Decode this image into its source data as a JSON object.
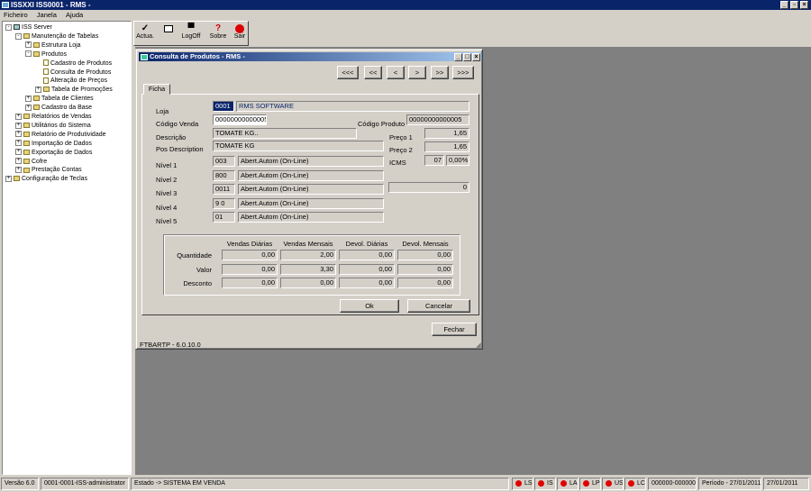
{
  "window": {
    "title": "ISSXXI ISS0001 - RMS -"
  },
  "menu": [
    "Ficheiro",
    "Janela",
    "Ajuda"
  ],
  "toolbar": [
    {
      "label": "Actua.",
      "icon": "check-icon"
    },
    {
      "label": "",
      "icon": "window-icon"
    },
    {
      "label": "LogOff",
      "icon": "logoff-icon"
    },
    {
      "label": "Sobre",
      "icon": "help-icon"
    },
    {
      "label": "Sair",
      "icon": "stop-icon"
    }
  ],
  "tree": [
    {
      "label": "ISS Server",
      "level": 0,
      "sign": "-",
      "kind": "computer"
    },
    {
      "label": "Manutenção de Tabelas",
      "level": 1,
      "sign": "-",
      "kind": "folder"
    },
    {
      "label": "Estrutura Loja",
      "level": 2,
      "sign": "+",
      "kind": "folder"
    },
    {
      "label": "Produtos",
      "level": 2,
      "sign": "-",
      "kind": "folder"
    },
    {
      "label": "Cadastro de Produtos",
      "level": 3,
      "sign": "",
      "kind": "doc"
    },
    {
      "label": "Consulta de Produtos",
      "level": 3,
      "sign": "",
      "kind": "doc"
    },
    {
      "label": "Alteração de Preços",
      "level": 3,
      "sign": "",
      "kind": "doc"
    },
    {
      "label": "Tabela de Promoções",
      "level": 3,
      "sign": "+",
      "kind": "folder"
    },
    {
      "label": "Tabela de Clientes",
      "level": 2,
      "sign": "+",
      "kind": "folder"
    },
    {
      "label": "Cadastro da Base",
      "level": 2,
      "sign": "+",
      "kind": "folder"
    },
    {
      "label": "Relatórios de Vendas",
      "level": 1,
      "sign": "+",
      "kind": "folder"
    },
    {
      "label": "Utilitários do Sistema",
      "level": 1,
      "sign": "+",
      "kind": "folder"
    },
    {
      "label": "Relatório de Produtividade",
      "level": 1,
      "sign": "+",
      "kind": "folder"
    },
    {
      "label": "Importação de Dados",
      "level": 1,
      "sign": "+",
      "kind": "folder"
    },
    {
      "label": "Exportação de Dados",
      "level": 1,
      "sign": "+",
      "kind": "folder"
    },
    {
      "label": "Cofre",
      "level": 1,
      "sign": "+",
      "kind": "folder"
    },
    {
      "label": "Prestação Contas",
      "level": 1,
      "sign": "+",
      "kind": "folder"
    },
    {
      "label": "Configuração de Teclas",
      "level": 0,
      "sign": "+",
      "kind": "folder"
    }
  ],
  "dialog": {
    "title": "Consulta de Produtos - RMS -",
    "nav": [
      "<<<",
      "<<",
      "<",
      ">",
      ">>",
      ">>>"
    ],
    "tab": "Ficha",
    "loja_label": "Loja",
    "loja_code": "0001",
    "loja_name": "RMS SOFTWARE",
    "codigo_venda_label": "Código Venda",
    "codigo_venda": "00000000000005",
    "codigo_produto_label": "Código Produto",
    "codigo_produto": "00000000000005",
    "descricao_label": "Descrição",
    "descricao": "TOMATE KG..",
    "pos_label": "Pos Description",
    "pos": "TOMATE KG",
    "preco1_label": "Preço 1",
    "preco1": "1,65",
    "preco2_label": "Preço 2",
    "preco2": "1,65",
    "icms_label": "ICMS",
    "icms_code": "07",
    "icms_pct": "0,00%",
    "extra_value": "0",
    "niveis": [
      {
        "label": "Nível 1",
        "code": "003",
        "desc": "Abert.Autom (On-Line)"
      },
      {
        "label": "Nível 2",
        "code": "800",
        "desc": "Abert.Autom (On-Line)"
      },
      {
        "label": "Nível 3",
        "code": "0011",
        "desc": "Abert.Autom (On-Line)"
      },
      {
        "label": "Nível 4",
        "code": "9  0",
        "desc": "Abert.Autom (On-Line)"
      },
      {
        "label": "Nível 5",
        "code": "01",
        "desc": "Abert.Autom (On-Line)"
      }
    ],
    "stats": {
      "columns": [
        "Vendas Diárias",
        "Vendas Mensais",
        "Devol. Diárias",
        "Devol. Mensais"
      ],
      "rows": [
        {
          "label": "Quantidade",
          "values": [
            "0,00",
            "2,00",
            "0,00",
            "0,00"
          ]
        },
        {
          "label": "Valor",
          "values": [
            "0,00",
            "3,30",
            "0,00",
            "0,00"
          ]
        },
        {
          "label": "Desconto",
          "values": [
            "0,00",
            "0,00",
            "0,00",
            "0,00"
          ]
        }
      ]
    },
    "ok": "Ok",
    "cancelar": "Cancelar",
    "fechar": "Fechar",
    "footer": "FTBARTP - 6.0.10.0"
  },
  "status": {
    "versao": "Versão 6.0",
    "user": "0001-0001-ISS-administrator",
    "estado": "Estado -> SISTEMA EM VENDA",
    "leds": [
      "LS",
      "IS",
      "LA",
      "LP",
      "US",
      "LC"
    ],
    "code": "000000-000000",
    "periodo": "Período - 27/01/2011",
    "date": "27/01/2011"
  },
  "colors": {
    "titlebar": "#0a246a",
    "desktop": "#808080",
    "led": "#e00000",
    "highlight": "#0a246a"
  }
}
